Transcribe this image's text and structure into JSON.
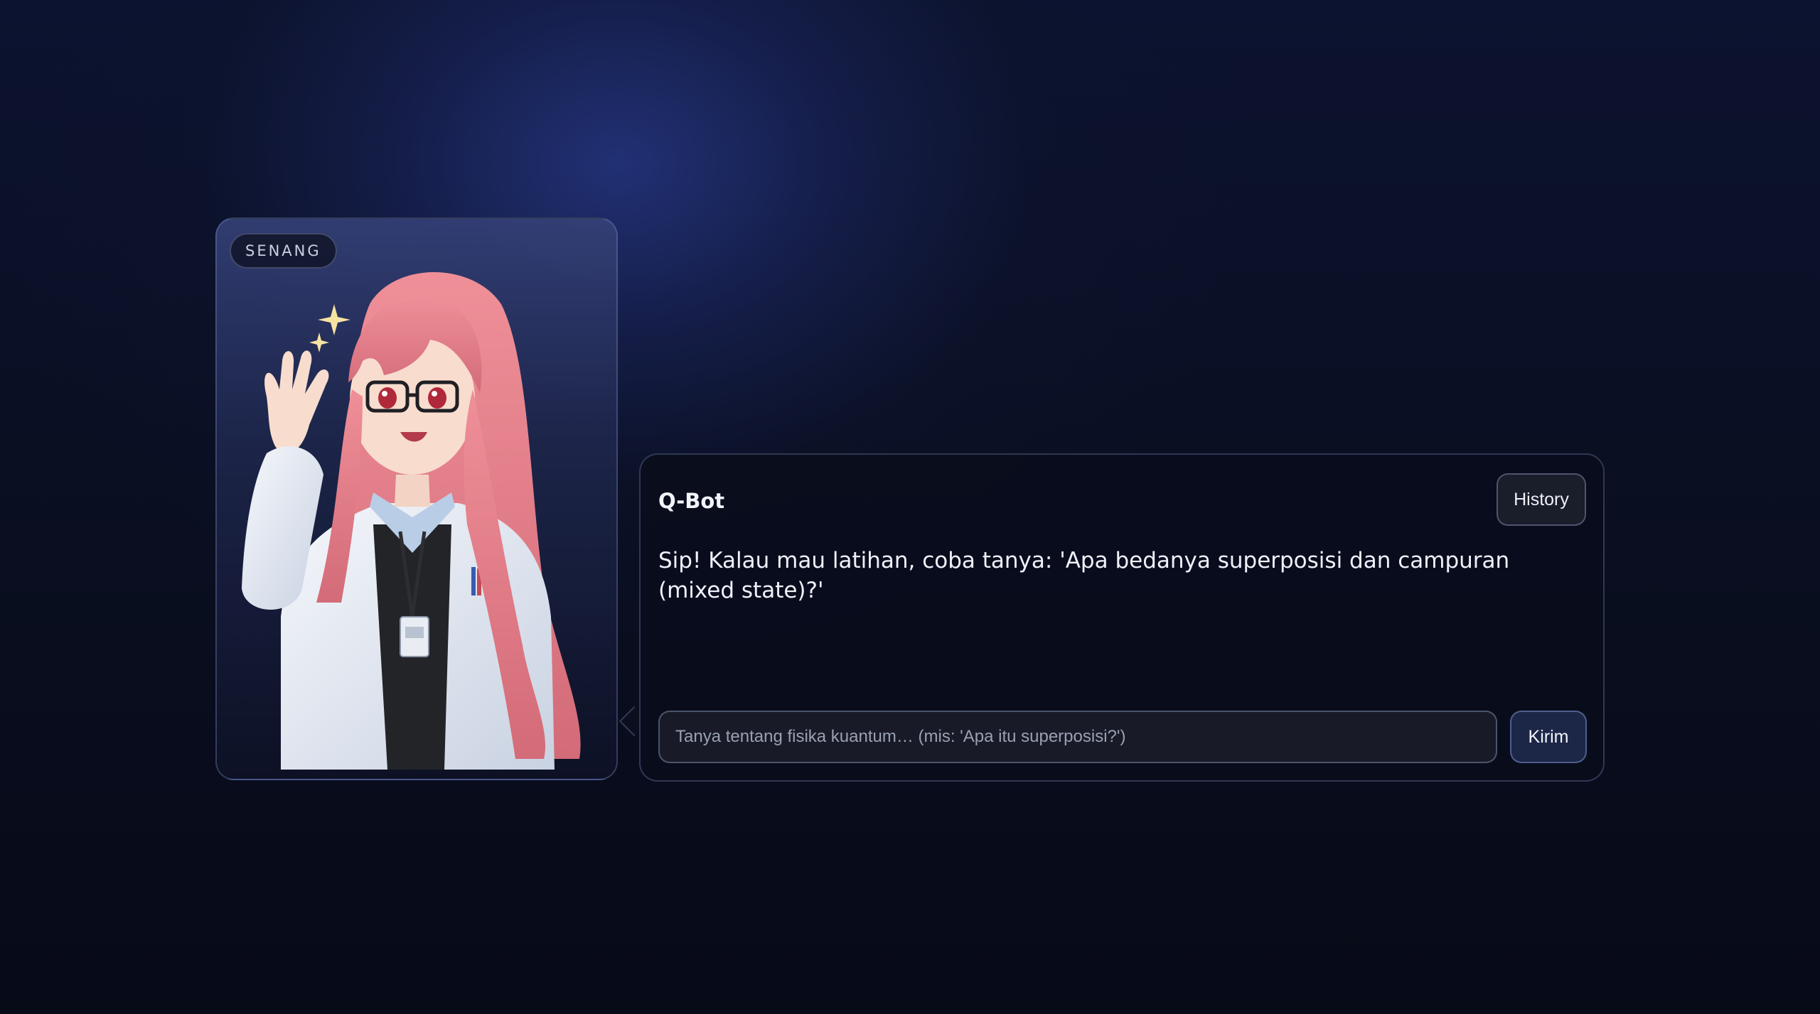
{
  "avatar": {
    "mood": "SENANG",
    "image_icon": "anime-scientist-waving-icon"
  },
  "chat": {
    "bot_name": "Q-Bot",
    "history_label": "History",
    "messages": [
      {
        "sender": "Q-Bot",
        "text": "Sip! Kalau mau latihan, coba tanya: 'Apa bedanya superposisi dan campuran (mixed state)?'"
      }
    ],
    "input": {
      "value": "",
      "placeholder": "Tanya tentang fisika kuantum… (mis: 'Apa itu superposisi?')"
    },
    "send_label": "Kirim"
  },
  "colors": {
    "background": "#0a0f22",
    "accent": "#1c2748",
    "hair": "#e07c86",
    "sparkle": "#f6e3a2"
  }
}
